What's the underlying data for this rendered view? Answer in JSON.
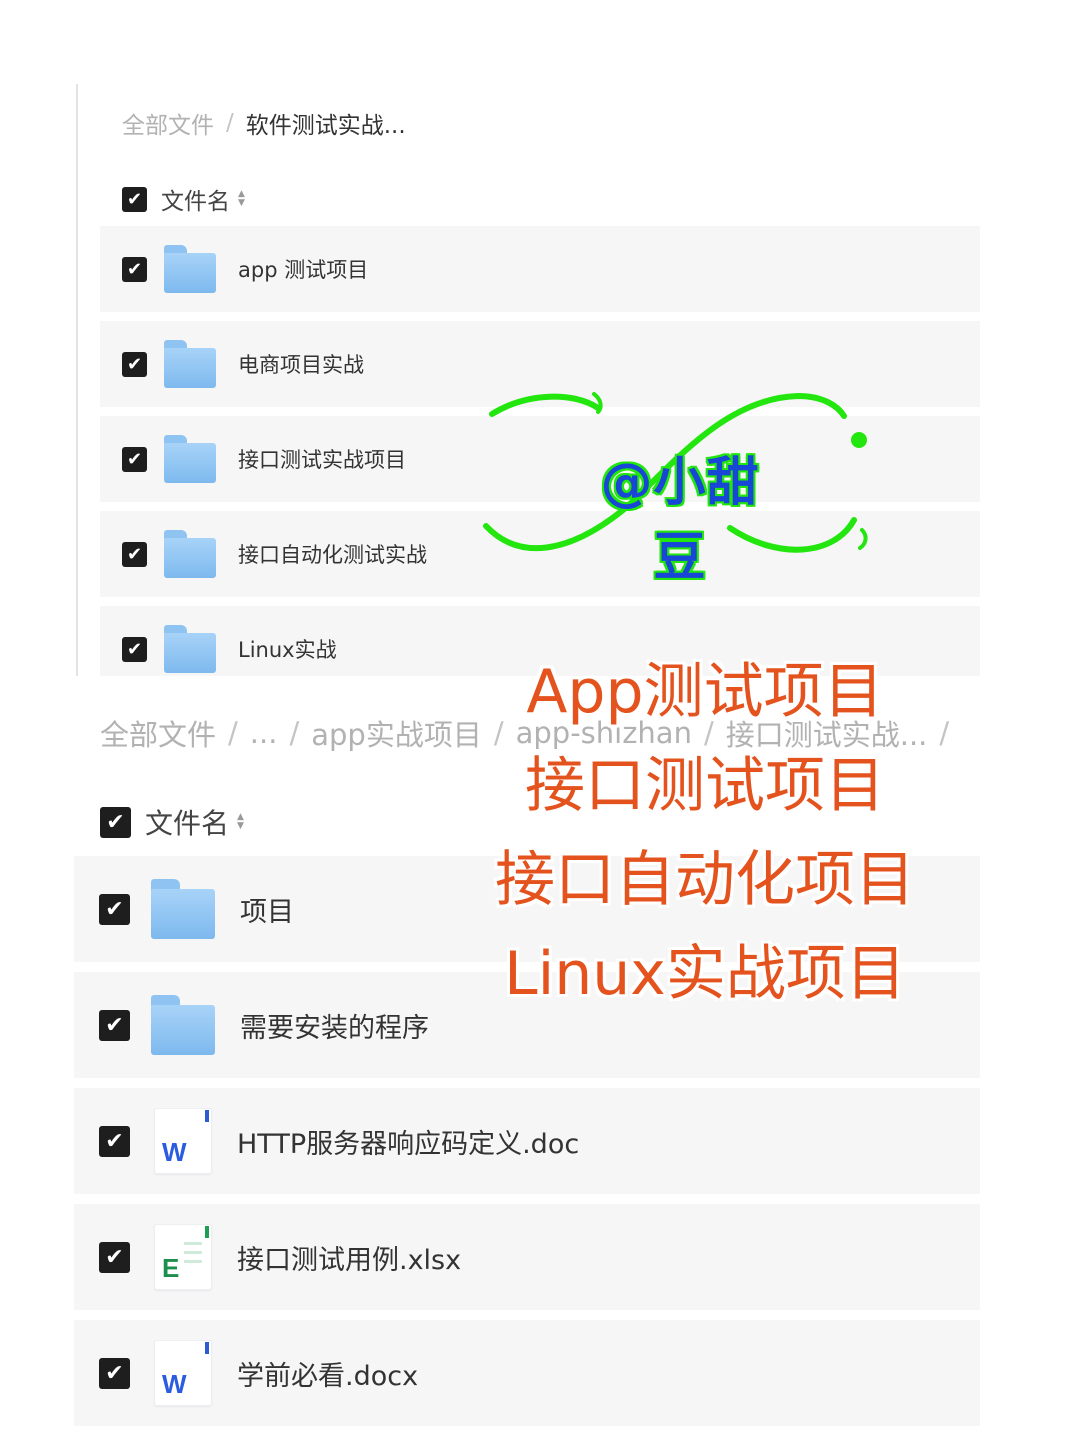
{
  "top_panel": {
    "breadcrumb": [
      "全部文件",
      "软件测试实战..."
    ],
    "header": "文件名",
    "items": [
      {
        "name": "app 测试项目",
        "type": "folder"
      },
      {
        "name": "电商项目实战",
        "type": "folder"
      },
      {
        "name": "接口测试实战项目",
        "type": "folder"
      },
      {
        "name": "接口自动化测试实战",
        "type": "folder"
      },
      {
        "name": "Linux实战",
        "type": "folder"
      }
    ]
  },
  "bottom_panel": {
    "breadcrumb": [
      "全部文件",
      "...",
      "app实战项目",
      "app-shizhan",
      "接口测试实战...",
      ""
    ],
    "header": "文件名",
    "items": [
      {
        "name": "项目",
        "type": "folder",
        "icon": "folder-icon"
      },
      {
        "name": "需要安装的程序",
        "type": "folder",
        "icon": "folder-icon"
      },
      {
        "name": "HTTP服务器响应码定义.doc",
        "type": "doc",
        "icon": "word-doc-icon",
        "letter": "W"
      },
      {
        "name": "接口测试用例.xlsx",
        "type": "xlsx",
        "icon": "excel-doc-icon",
        "letter": "E"
      },
      {
        "name": "学前必看.docx",
        "type": "docx",
        "icon": "word-doc-icon",
        "letter": "W"
      }
    ]
  },
  "watermark": {
    "text": "@小甜豆",
    "color": "#1846d6",
    "outline_color": "#22e60e"
  },
  "overlay": {
    "lines": [
      "App测试项目",
      "接口测试项目",
      "接口自动化项目",
      "Linux实战项目"
    ],
    "color": "#e4531d"
  },
  "checkbox_mark": "✔",
  "sort_arrows": {
    "up": "▲",
    "down": "▼"
  }
}
